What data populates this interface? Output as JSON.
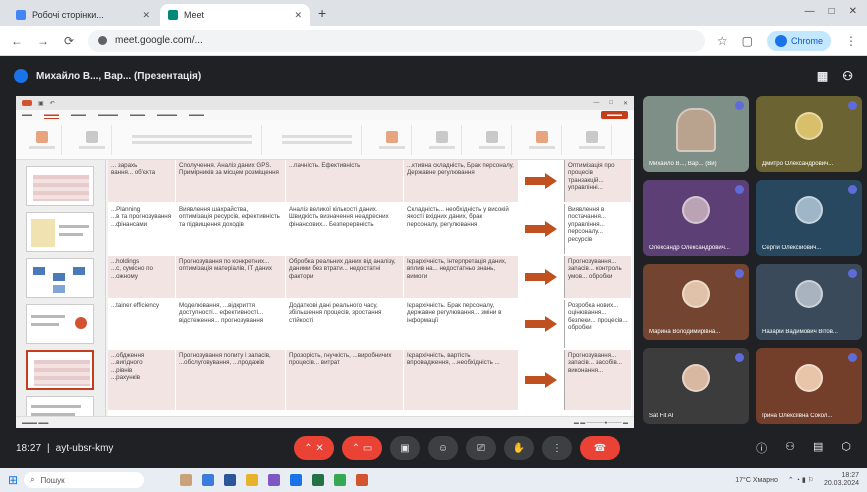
{
  "browser": {
    "tabs": [
      {
        "title": "Робочі сторінки...",
        "favicon_color": "#4285f4",
        "active": false
      },
      {
        "title": "Meet",
        "favicon_color": "#00897b",
        "active": true
      }
    ],
    "address": "meet.google.com/...",
    "profile_label": "Chrome"
  },
  "meet": {
    "presenter_label": "Михайло В..., Вар... (Презентація)",
    "meeting_time": "18:27",
    "meeting_code": "ayt-ubsr-kmy"
  },
  "slide": {
    "rows": [
      {
        "c0": "... зарахь\nвання... об'єкта",
        "c1": "Сполучення. Аналіз даних GPS. Примірників за місцем розміщення",
        "c2": "...пачність. Ефективність",
        "c3": "...ктивна складність, Брак персоналу, Державне регулювання",
        "c5": "Оптимізація про процесів транзакцій... управлінні...",
        "bg": "#f3e4e4"
      },
      {
        "c0": "...Planning\n...в та прогнозування\n...фінансами",
        "c1": "Виявлення шахрайства, оптимізація ресурсів, ефективність та підвищення доходів",
        "c2": "Аналіз великої кількості даних. Швидкість визначення неадресних фінансових... Безперервність",
        "c3": "Складність... необхідність у високій якості вхідних даних, брак персоналу, регулювання",
        "c5": "Виявлення в постачання... управління... персоналу... ресурсів",
        "bg": "#ffffff"
      },
      {
        "c0": "...holdings\n...с, сумісно по\n...ожному",
        "c1": "Прогнозування по конкретних... оптимізація матеріалів, ІТ даних",
        "c2": "Обробка реальних даних від аналізу, даними без втрати... недостатні фактори",
        "c3": "Ієрархічність, інтерпретація даних, вплив на... недостатньо знань, вимоги",
        "c5": "Прогнозування... запасів... контроль умов... обробки",
        "bg": "#f3e4e4"
      },
      {
        "c0": "...tainer efficiency",
        "c1": "Моделювання, ...відкриття доступності... ефективності... відстеження... прогнозування",
        "c2": "Додаткові дані реального часу, збільшення процесів, зростання стійкості",
        "c3": "Ієрархічність. Брак персоналу, державне регулювання... зміни в інформації",
        "c5": "Розробка нових... оцінювання... безпеки... процесів... обробки",
        "bg": "#ffffff"
      },
      {
        "c0": "...обдження\n...вигідного\n...рівнів\n...рахунків",
        "c1": "Прогнозування попиту і запасів, ...обслуговування, ...продажів",
        "c2": "Прозорість, гнучкість, ...виробничих процесів... витрат",
        "c3": "Ієрархічність, вартість впровадження, ...необхідність ...",
        "c5": "Прогнозування... запасів... засобів... виконання...",
        "bg": "#f3e4e4"
      }
    ]
  },
  "participants": [
    {
      "name": "Михайло В..., Вар... (Ви)",
      "bg": "#7d8f86",
      "avatar": "#b9a38f"
    },
    {
      "name": "Дмитро Олександрович...",
      "bg": "#6b6331",
      "avatar": "#d8c06a"
    },
    {
      "name": "Олександр Олександрович...",
      "bg": "#5b3f75",
      "avatar": "#b9a3b5"
    },
    {
      "name": "Сергій Олексійович...",
      "bg": "#27485e",
      "avatar": "#9fb6c9"
    },
    {
      "name": "Марина Володимирівна...",
      "bg": "#73442f",
      "avatar": "#e0c2a8"
    },
    {
      "name": "Назарій Вадимович Вітов...",
      "bg": "#3b4a5a",
      "avatar": "#a8b3bf"
    },
    {
      "name": "Sat Fit AI",
      "bg": "#3c3c3c",
      "avatar": "#d8b8a0"
    },
    {
      "name": "Ірина Олексіївна Сокол...",
      "bg": "#733f2a",
      "avatar": "#e8c4a8"
    }
  ],
  "taskbar": {
    "search_placeholder": "Пошук",
    "weather": "17°C Хмарно",
    "time": "18:27",
    "date": "20.03.2024"
  },
  "colors": {
    "accent_red": "#ea4335",
    "ppt_orange": "#c43e1c",
    "arrow": "#c0501f"
  }
}
